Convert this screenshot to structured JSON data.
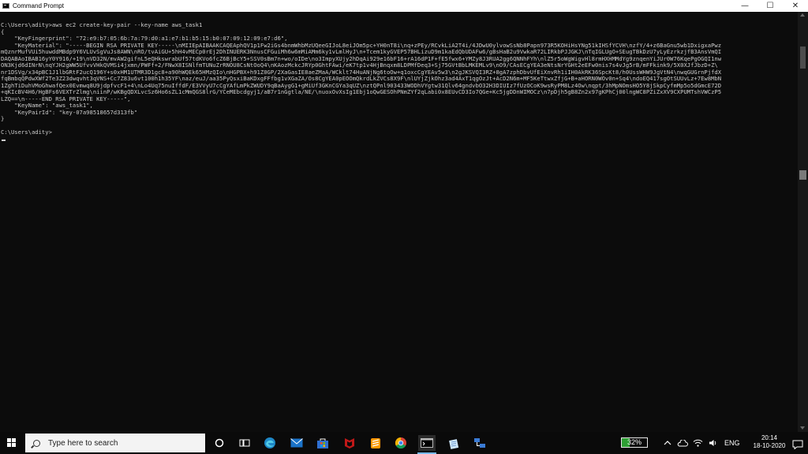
{
  "window": {
    "title": "Command Prompt",
    "controls": {
      "minimize": "—",
      "maximize": "☐",
      "close": "✕"
    }
  },
  "console": {
    "lines": [
      "C:\\Users\\adity>aws ec2 create-key-pair --key-name aws_task1",
      "{",
      "    \"KeyFingerprint\": \"72:e9:b7:05:6b:7a:79:d0:a1:e7:b1:b5:15:b0:07:09:12:09:e7:d6\",",
      "    \"KeyMaterial\": \"-----BEGIN RSA PRIVATE KEY-----\\nMIIEpAIBAAKCAQEAphQV1p1Fw2iGs4bnmWhbMzUQeeGIJoL8eiJOm5pc+YH0nT8i\\nq+zPEy/RCvkLiA2T4i/4JDwU0ylvowSsNb8Papn973R5KOHiHsYNg51kIHSfYCVH\\nzfY/4+z6BaGnu5wb1DxigxaPwz",
      "mQznrMufVUi5huwddMBdp9Y6VLUvSgVuJs8AWN\\nRO/tvAiGU+5hH4vMECp0rEj2DhINUERK3NnusCFGuiMh6w6mMiAMm6ky1vLmlHyJ\\n+Tcem1kyGVEP57BHLizuD9m1kaEdQbUDAFw6/gBsHaB2u9VwkaR72LIRkbPJJGKJ\\nTqIGLUgO+SEugTBkDzU7yLyEzrkzjfB3AnsVmQI",
      "DAQABAoIBAB16yY0Y916/+19\\nVD32N/mvAW2gifnL5eQHkswrabUf57tdKVo6fcZ6BjBcY5+SSV0sBm7n+wo/oIDe\\no3ImpyXUjy2hDqAi929e16bF16+rA16dP1F+fE5fwx6+YMZy8J3RUA2gg6QNNhFYh\\nlZ5r5oWgWigvHl8rmHXHMMdYg9znqenYiJUr0W76KqePgOGQI1nw",
      "ON3Kjd6dINrN\\nqYJH2gWW5UfvvVHkQVMSi4jxmn/PWFf+2/FNwX8ISNlfmTUNuZrRNOU8CsNtOoQ4\\nKAozMckcJRYp0GhtFAwi/eK7tp1v4HjBnqxm8LDPMfDeq3+Sj75GVtBbLMKEMLv9\\nO9/CAsECgYEA3eNtsNrYGHt2eEFw0nis7s4vJg5rB/mFFkink9/5X0XJfJbzD+Z\\",
      "nr1DSVg/x34pBC1J1lbGRtF2ucQ196Y+s0xHM1UTMR3D1gc8+a90hWQEk65HMzQIo\\nHGPBX+h91Z0GP/2XaGasIE8aeZMaA/WCklt74HuANjNg6toOw+q1oxcCgYEAv5w3\\n2gJKSVQI3RZ+8gA7zphDbvUfEiXnvRh1iIH0AkRK36SpcKt8/h0UssWHW9JgVtN4\\nwqGUGrnPjfdX",
      "fqBmbqQPdwXWf2Te3Z23dwqvht3qVNS+Cc7Z83u6vt100h1h35YF\\naz/euJ/aa35PyQsxiBaKDxgFFfbg1vXGaZA/Os8CgYEA0pEOOmQkrdLkZVCs8X9F\\nlUYjZjkOhz3ad4AxT1qgOzJt+AcD2N6m+MF5KeTtwxZfjG+B+aHORN0WOv0n+Sq4\\ndoEQ417sgOtSUUvLz+7Ew8MbN",
      "1ZghTiDuhVMoGhwafQex0Evmwq8U9jdpfvcF1+4\\nLo4Uq75nuIffdF/E3VVyU7cCgYAfLmPkZWUDY9qBaAygG1+gMiUf3GKnCGYa3qUZ\\nztQPnl903433WODhVYgtw31Qlv64gndvbO32H3DIUIz7fUzOCoK9wsRyPM8Lz4Ow\\nqpt/3hMpNOmsHO5Y8jSkpCyfmMp5o5dGmcE72D",
      "+qKIcBV4H6/HgBFs6VEXTrZlmg\\niinP/wKBgQDXLvcSz6Ho6sZL1cMmQGS8lrG/YCeMEbcdgyj1/aB7r1nGgtla/NE/\\nuoxOvXsIg1Ebj1oQwGESOhPNmZYf2qLabi0x8EUvCD3Io7QGe+Kc5jgDDnWIMOCz\\n7pDjh5gB8Zn2x97gKPhCj00lngWC8PZiZxXV9CXPUMTshVWCzP5",
      "LZQ==\\n-----END RSA PRIVATE KEY-----\",",
      "    \"KeyName\": \"aws_task1\",",
      "    \"KeyPairId\": \"key-07a98518657d313fb\"",
      "}",
      "",
      "C:\\Users\\adity>"
    ]
  },
  "taskbar": {
    "search_placeholder": "Type here to search",
    "icons": [
      "windows-start-icon",
      "cortana-icon",
      "task-view-icon",
      "edge-icon",
      "mail-icon",
      "store-icon",
      "mcafee-icon",
      "sublime-icon",
      "chrome-icon",
      "cmd-icon",
      "notepad-icon",
      "network-app-icon"
    ],
    "battery_percent": "32%",
    "battery_level": 0.32,
    "language": "ENG",
    "time": "20:14",
    "date": "18-10-2020"
  },
  "colors": {
    "console_bg": "#0c0c0c",
    "console_text": "#cccccc",
    "taskbar_bg": "#0a0a0a",
    "battery_green": "#2d9f33",
    "active_indicator": "#76b9ed"
  }
}
